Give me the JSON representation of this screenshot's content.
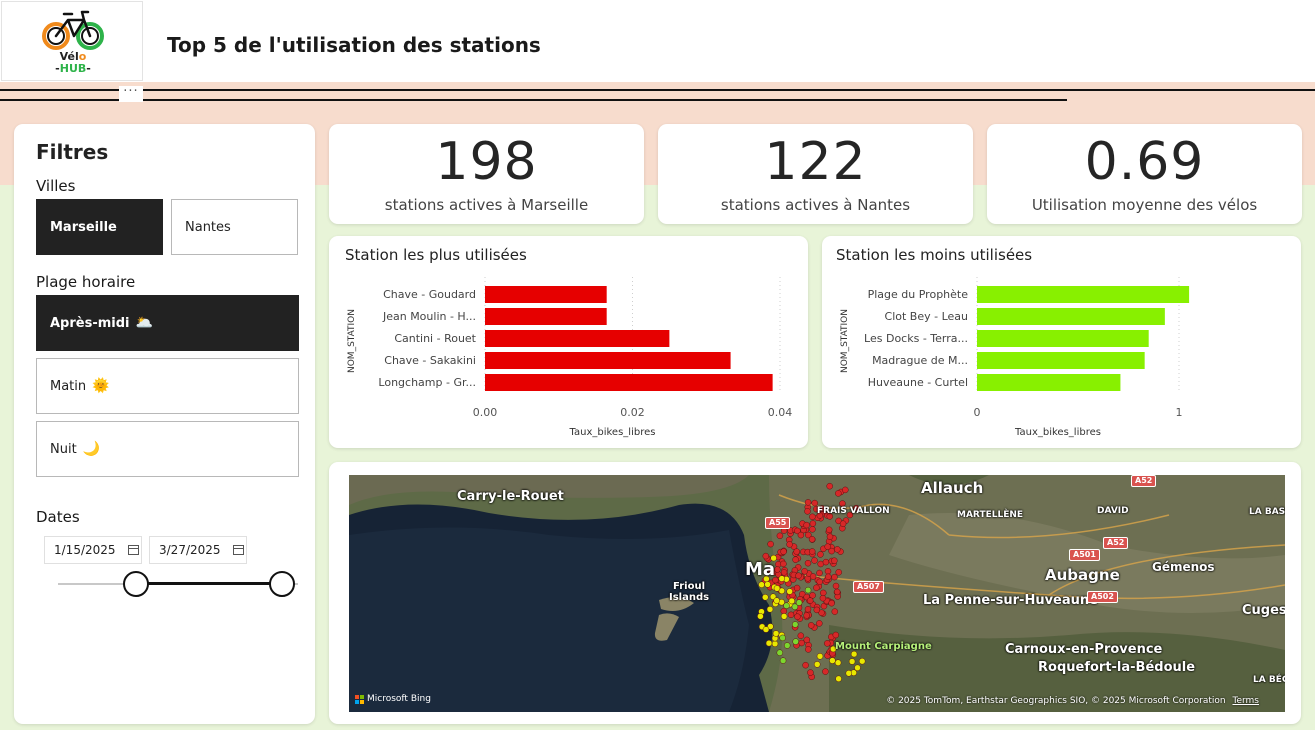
{
  "header": {
    "title": "Top 5 de l'utilisation des stations",
    "logo": {
      "line1_prefix": "Vél",
      "line1_accent": "o",
      "line2_prefix": "-",
      "line2_accent": "HUB",
      "line2_suffix": "-"
    },
    "more_glyph": "···"
  },
  "filters": {
    "title": "Filtres",
    "cities_label": "Villes",
    "cities": [
      {
        "label": "Marseille",
        "selected": true
      },
      {
        "label": "Nantes",
        "selected": false
      }
    ],
    "time_label": "Plage horaire",
    "time_slots": [
      {
        "label": "Après-midi",
        "emoji": "🌥️",
        "selected": true
      },
      {
        "label": "Matin",
        "emoji": "🌞",
        "selected": false
      },
      {
        "label": "Nuit",
        "emoji": "🌙",
        "selected": false
      }
    ],
    "dates_label": "Dates",
    "date_start": "1/15/2025",
    "date_end": "3/27/2025"
  },
  "kpis": [
    {
      "value": "198",
      "label": "stations actives à Marseille"
    },
    {
      "value": "122",
      "label": "stations actives à Nantes"
    },
    {
      "value": "0.69",
      "label": "Utilisation moyenne des vélos"
    }
  ],
  "chart_data": [
    {
      "type": "bar",
      "orientation": "horizontal",
      "title": "Station les plus utilisées",
      "xlabel": "Taux_bikes_libres",
      "ylabel": "NOM_STATION",
      "categories": [
        "Chave - Goudard",
        "Jean Moulin - H...",
        "Cantini - Rouet",
        "Chave - Sakakini",
        "Longchamp - Gr..."
      ],
      "values": [
        0.0165,
        0.0165,
        0.025,
        0.0333,
        0.039
      ],
      "xlim": [
        0,
        0.04
      ],
      "xticks": [
        "0.00",
        "0.02",
        "0.04"
      ],
      "xtick_values": [
        0,
        0.02,
        0.04
      ],
      "color": "#e60000",
      "grid": "vertical dotted"
    },
    {
      "type": "bar",
      "orientation": "horizontal",
      "title": "Station les moins utilisées",
      "xlabel": "Taux_bikes_libres",
      "ylabel": "NOM_STATION",
      "categories": [
        "Plage du Prophète",
        "Clot Bey - Leau",
        "Les Docks - Terra...",
        "Madrague de M...",
        "Huveaune - Curtel"
      ],
      "values": [
        1.05,
        0.93,
        0.85,
        0.83,
        0.71
      ],
      "xlim": [
        0,
        1
      ],
      "xticks": [
        "0",
        "1"
      ],
      "xtick_values": [
        0,
        1
      ],
      "color": "#88f000",
      "grid": "vertical dotted"
    }
  ],
  "map": {
    "places": [
      {
        "name": "Carry-le-Rouet"
      },
      {
        "name": "Allauch"
      },
      {
        "name": "MARTELLÈNE"
      },
      {
        "name": "DAVID"
      },
      {
        "name": "LA BASSE"
      },
      {
        "name": "FRAIS VALLON"
      },
      {
        "name": "Ma"
      },
      {
        "name": "Aubagne"
      },
      {
        "name": "Gémenos"
      },
      {
        "name": "La Penne-sur-Huveaune"
      },
      {
        "name": "Cuges-le"
      },
      {
        "name": "Frioul\nIslands"
      },
      {
        "name": "Mount Carpiagne"
      },
      {
        "name": "Carnoux-en-Provence"
      },
      {
        "name": "Roquefort-la-Bédoule"
      },
      {
        "name": "LA BÉGU"
      }
    ],
    "roads": [
      "A52",
      "A55",
      "A52",
      "A501",
      "A507",
      "A502"
    ],
    "provider": "Microsoft Bing",
    "copyright": "© 2025 TomTom, Earthstar Geographics SIO, © 2025 Microsoft Corporation",
    "terms": "Terms"
  },
  "colors": {
    "peach_band": "#f7dccd",
    "green_band": "#e8f4d8",
    "bar_top": "#e60000",
    "bar_bottom": "#88f000",
    "dot_red": "#d62828",
    "dot_yellow": "#e8e800",
    "dot_green": "#7bd62f"
  }
}
